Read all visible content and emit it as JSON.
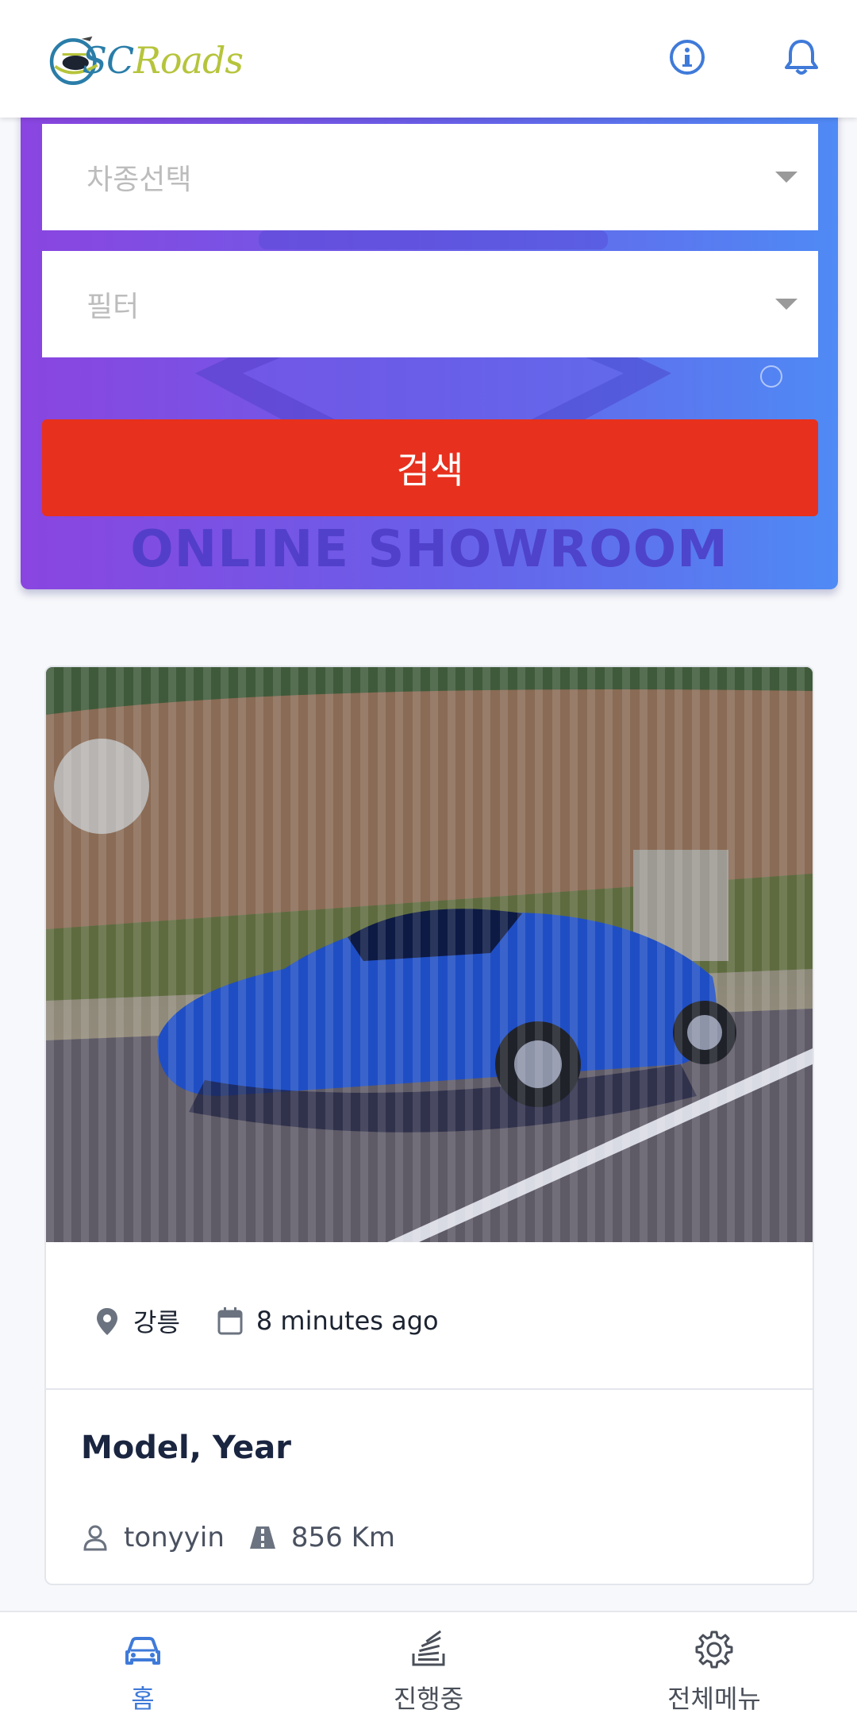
{
  "header": {
    "logo_prefix": "SC",
    "logo_suffix": "Roads",
    "info_icon": "info-icon",
    "bell_icon": "bell-icon"
  },
  "search": {
    "vehicle_type_placeholder": "차종선택",
    "filter_placeholder": "필터",
    "search_button": "검색",
    "banner_text": "ONLINE SHOWROOM"
  },
  "listing": {
    "location": "강릉",
    "time_posted": "8 minutes ago",
    "title": "Model, Year",
    "user": "tonyyin",
    "mileage": "856 Km"
  },
  "bottom_nav": {
    "items": [
      {
        "label": "홈",
        "icon": "car-icon",
        "active": true
      },
      {
        "label": "진행중",
        "icon": "stack-icon",
        "active": false
      },
      {
        "label": "전체메뉴",
        "icon": "gear-icon",
        "active": false
      }
    ]
  },
  "colors": {
    "accent": "#3f7ad9",
    "search_button": "#e7301d",
    "hero_gradient_start": "#8a45e0",
    "hero_gradient_end": "#4f8af5"
  }
}
